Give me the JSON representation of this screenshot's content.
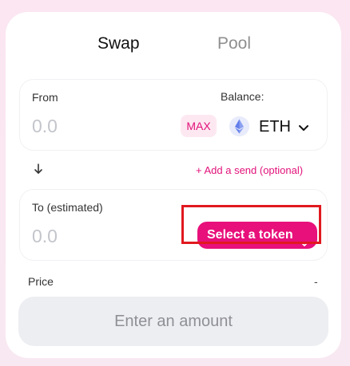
{
  "tabs": {
    "swap": "Swap",
    "pool": "Pool"
  },
  "from": {
    "label": "From",
    "balance_label": "Balance:",
    "amount_placeholder": "0.0",
    "max_label": "MAX",
    "token_symbol": "ETH"
  },
  "add_send_label": "+ Add a send (optional)",
  "to": {
    "label": "To (estimated)",
    "balance_value": "-",
    "amount_placeholder": "0.0",
    "select_token_label": "Select a token"
  },
  "price": {
    "label": "Price",
    "value": "-"
  },
  "submit_label": "Enter an amount",
  "colors": {
    "accent": "#e8107a",
    "highlight": "#e0191f",
    "eth": "#627eea"
  },
  "icons": {
    "token": "ethereum-icon",
    "chevron": "chevron-down-icon",
    "arrow": "arrow-down-icon"
  }
}
